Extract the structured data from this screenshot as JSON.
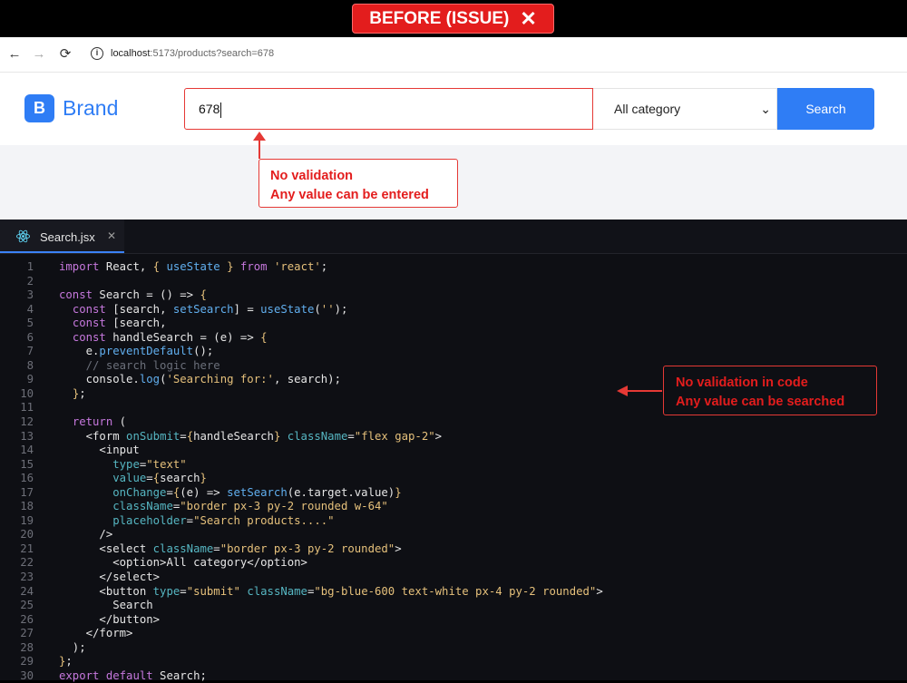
{
  "banner": {
    "label": "BEFORE (ISSUE)",
    "icon": "close-x-icon"
  },
  "browser": {
    "url_host": "localhost",
    "url_rest": ":5173/products?search=678"
  },
  "app": {
    "logo_letter": "B",
    "brand": "Brand",
    "search_value": "678",
    "category_selected": "All category",
    "search_button": "Search"
  },
  "annotations": {
    "top_line1": "No validation",
    "top_line2": "Any value can be entered",
    "code_line1": "No validation in code",
    "code_line2": "Any value can be searched"
  },
  "editor": {
    "tab_name": "Search.jsx",
    "lines": [
      "import React, { useState } from 'react';",
      "",
      "const Search = () => {",
      "  const [search, setSearch] = useState('');",
      "  const [search, ",
      "  const handleSearch = (e) => {",
      "    e.preventDefault();",
      "    // search logic here",
      "    console.log('Searching for:', search);",
      "  };",
      "",
      "  return (",
      "    <form onSubmit={handleSearch} className=\"flex gap-2\">",
      "      <input",
      "        type=\"text\"",
      "        value={search}",
      "        onChange={(e) => setSearch(e.target.value)}",
      "        className=\"border px-3 py-2 rounded w-64\"",
      "        placeholder=\"Search products....\"",
      "      />",
      "      <select className=\"border px-3 py-2 rounded\">",
      "        <option>All category</option>",
      "      </select>",
      "      <button type=\"submit\" className=\"bg-blue-600 text-white px-4 py-2 rounded\">",
      "        Search",
      "      </button>",
      "    </form>",
      "  );",
      "};",
      "export default Search;"
    ]
  }
}
